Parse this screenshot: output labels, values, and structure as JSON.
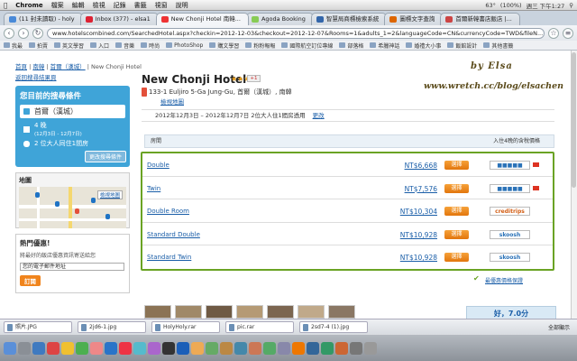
{
  "menubar": {
    "app": "Chrome",
    "items": [
      "檔案",
      "編輯",
      "檢視",
      "記錄",
      "書籤",
      "視窗",
      "說明"
    ],
    "tray": {
      "temp": "63°",
      "battery": "(100%)",
      "clock": "週三 下午1:27"
    }
  },
  "tabs": [
    {
      "label": "(11 封未讀取) - holy",
      "color": "#4a8ad8"
    },
    {
      "label": "Inbox (377) - elsa1",
      "color": "#d23"
    },
    {
      "label": "New Chonji Hotel 南韓...",
      "color": "#e33",
      "active": true
    },
    {
      "label": "Agoda Booking",
      "color": "#8c5"
    },
    {
      "label": "智慧局商標檢索系統",
      "color": "#36a"
    },
    {
      "label": "圖標文字查詢",
      "color": "#d60"
    },
    {
      "label": "首爾新韓書店飯店 |...",
      "color": "#c44"
    }
  ],
  "toolbar": {
    "url": "www.hotelscombined.com/SearchedHotel.aspx?checkin=2012-12-03&checkout=2012-12-07&Rooms=1&adults_1=2&languageCode=CN&currencyCode=TWD&fileN..."
  },
  "bookmarks": [
    "我最",
    "拍賣",
    "英文學習",
    "入口",
    "音樂",
    "時尚",
    "PhotoShop",
    "購文學習",
    "粉粉報報",
    "國際航空訂位專線",
    "部落格",
    "希臘神話",
    "婚禮大小事",
    "飯館設計",
    "其他書籤"
  ],
  "page": {
    "breadcrumb": [
      "首頁",
      "南韓",
      "首爾（漢城）",
      "New Chonji Hotel"
    ],
    "back_link": "返回搜尋結果頁",
    "search": {
      "title": "您目前的搜尋條件",
      "city": "首爾（漢城）",
      "nights": "4 晚",
      "nights_dates": "(12月3日 - 12月7日)",
      "guests": "2 位大人同住1間房",
      "edit_button": "更改搜尋條件"
    },
    "map": {
      "title": "地圖",
      "link": "檢視地圖"
    },
    "deal": {
      "title": "熱門優惠!",
      "text": "將最好的飯店優惠資訊寄送給您",
      "email_placeholder": "您的電子郵件地址",
      "button": "訂閱"
    },
    "hotel": {
      "name": "New Chonji Hotel",
      "stars": "★★★",
      "gplus": "+1",
      "address": "133-1 Euljiro 5-Ga Jung-Gu, 首爾（漢城）, 南韓",
      "map_link": "檢視地圖",
      "dates": "2012年12月3日 – 2012年12月7日 2位大人住1間房透用",
      "change": "更改"
    },
    "watermark": {
      "line1": "by Elsa",
      "line2": "www.wretch.cc/blog/elsachen"
    },
    "table": {
      "col_room": "房間",
      "col_price": "入住4晚的含稅價格",
      "rooms": [
        {
          "name": "Double",
          "price": "NT$6,668",
          "button": "選擇",
          "provider": "■■■■■"
        },
        {
          "name": "Twin",
          "price": "NT$7,576",
          "button": "選擇",
          "provider": "■■■■■"
        },
        {
          "name": "Double Room",
          "price": "NT$10,304",
          "button": "選擇",
          "provider": "creditrips"
        },
        {
          "name": "Standard Double",
          "price": "NT$10,928",
          "button": "選擇",
          "provider": "skoosh"
        },
        {
          "name": "Standard Twin",
          "price": "NT$10,928",
          "button": "選擇",
          "provider": "skoosh"
        }
      ],
      "more_link": "最優惠價格保證"
    },
    "rating": "好，7.0分"
  },
  "downloads": {
    "items": [
      "照片.JPG",
      "2jd6-1.jpg",
      "HolyHoly.rar",
      "pic.rar",
      "2sd7-4 (1).jpg"
    ],
    "show_all": "全部顯示"
  },
  "colors": {
    "accent": "#3fa4d8",
    "highlight": "#6aa324",
    "button": "#f0841c"
  }
}
